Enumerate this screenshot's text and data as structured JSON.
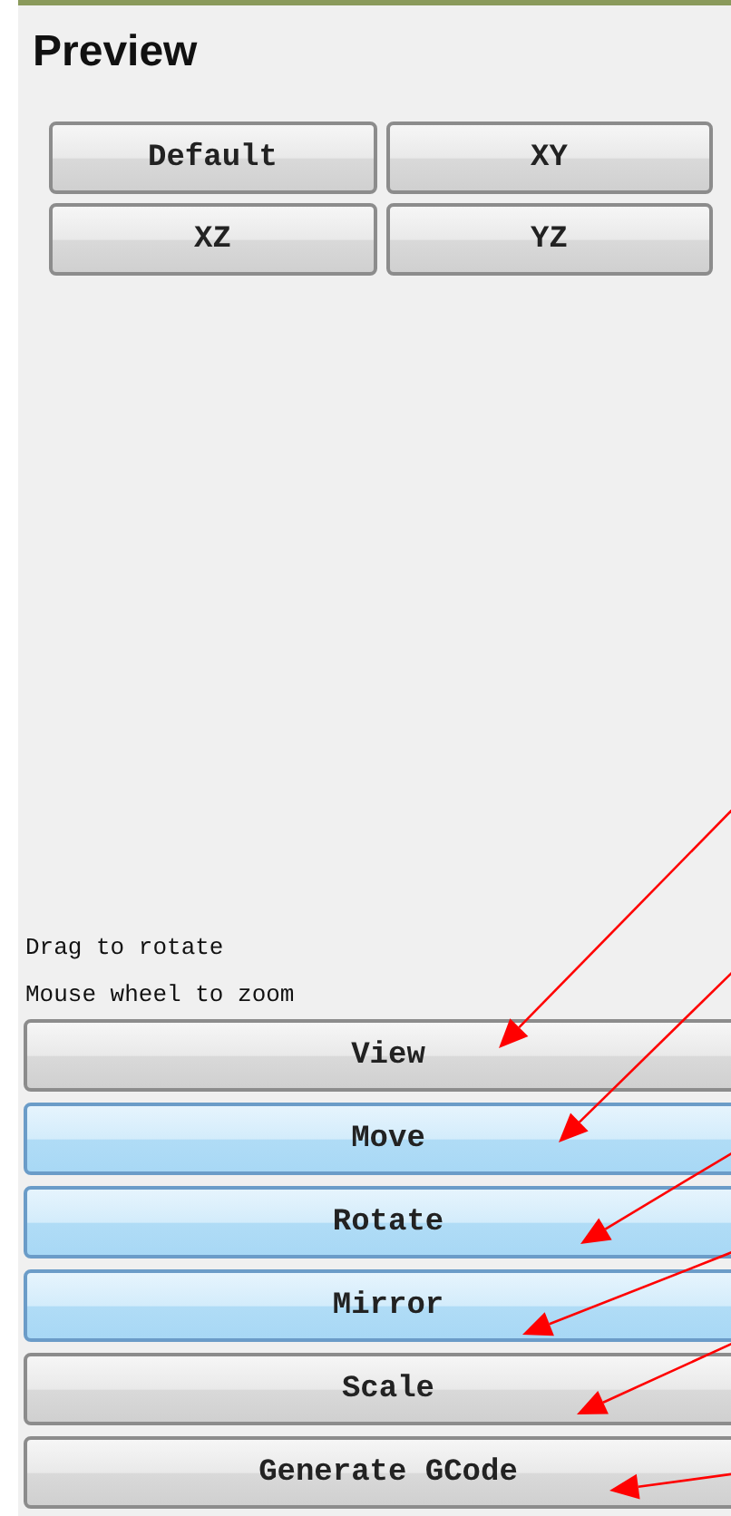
{
  "panel": {
    "title": "Preview"
  },
  "view_buttons": [
    {
      "label": "Default"
    },
    {
      "label": "XY"
    },
    {
      "label": "XZ"
    },
    {
      "label": "YZ"
    }
  ],
  "hints": [
    "Drag to rotate",
    "Mouse wheel to zoom"
  ],
  "action_buttons": [
    {
      "label": "View",
      "selected": false
    },
    {
      "label": "Move",
      "selected": true
    },
    {
      "label": "Rotate",
      "selected": true
    },
    {
      "label": "Mirror",
      "selected": true
    },
    {
      "label": "Scale",
      "selected": false
    },
    {
      "label": "Generate GCode",
      "selected": false
    }
  ]
}
